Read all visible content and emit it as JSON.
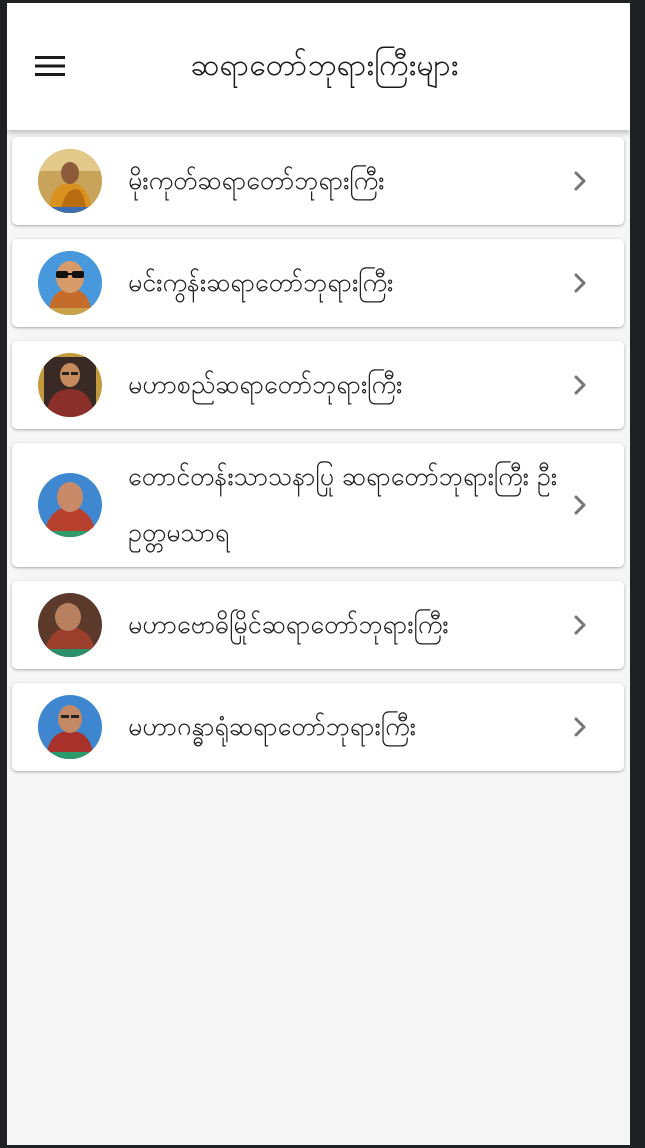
{
  "app_bar": {
    "title": "ဆရာတော်ဘုရားကြီးများ",
    "menu_icon": "hamburger-menu-icon"
  },
  "list": {
    "items": [
      {
        "label": "မိုးကုတ်ဆရာတော်ဘုရားကြီး",
        "avatar_icon": "monk-portrait"
      },
      {
        "label": "မင်းကွန်းဆရာတော်ဘုရားကြီး",
        "avatar_icon": "monk-portrait"
      },
      {
        "label": "မဟာစည်ဆရာတော်ဘုရားကြီး",
        "avatar_icon": "monk-portrait"
      },
      {
        "label": "တောင်တန်းသာသနာပြု ဆရာတော်ဘုရားကြီး ဦးဥတ္တမသာရ",
        "avatar_icon": "monk-portrait"
      },
      {
        "label": "မဟာဗောဓိမြိုင်ဆရာတော်ဘုရားကြီး",
        "avatar_icon": "monk-portrait"
      },
      {
        "label": "မဟာဂန္ဓာရုံဆရာတော်ဘုရားကြီး",
        "avatar_icon": "monk-portrait"
      }
    ],
    "chevron_icon": "chevron-right-icon"
  },
  "colors": {
    "app_bar_bg": "#ffffff",
    "page_bg": "#f6f6f6",
    "card_bg": "#ffffff",
    "text": "#1f1f1f",
    "chevron": "#757575"
  }
}
